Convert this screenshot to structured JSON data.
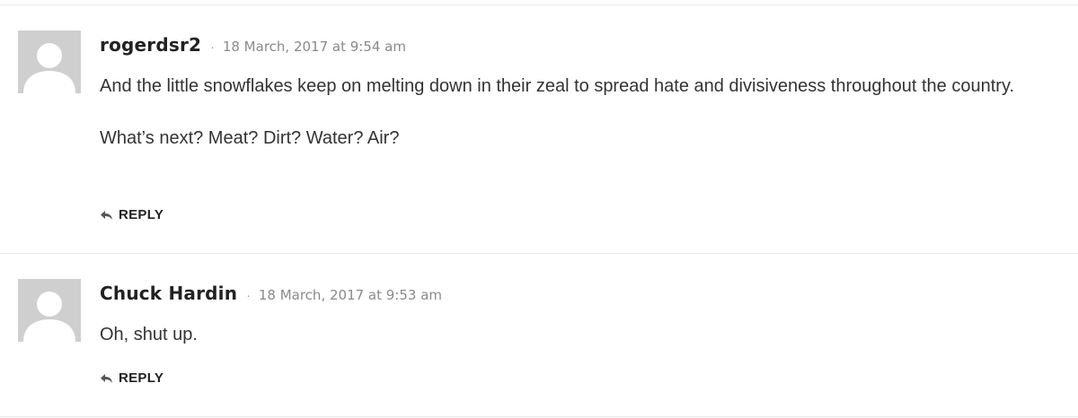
{
  "comments": [
    {
      "author": "rogerdsr2",
      "separator": "·",
      "date": "18 March, 2017 at 9:54 am",
      "paragraphs": [
        "And the little snowflakes keep on melting down in their zeal to spread hate and divisiveness throughout the country.",
        "What’s next? Meat? Dirt? Water? Air?"
      ],
      "reply_label": "REPLY",
      "avatar_icon": "user-placeholder-icon",
      "reply_icon": "reply-arrow-icon"
    },
    {
      "author": "Chuck Hardin",
      "separator": "·",
      "date": "18 March, 2017 at 9:53 am",
      "paragraphs": [
        "Oh, shut up."
      ],
      "reply_label": "REPLY",
      "avatar_icon": "user-placeholder-icon",
      "reply_icon": "reply-arrow-icon"
    }
  ],
  "colors": {
    "avatar_bg": "#cfcfcf",
    "divider": "#e8e8e8",
    "date": "#8a8a8a"
  }
}
